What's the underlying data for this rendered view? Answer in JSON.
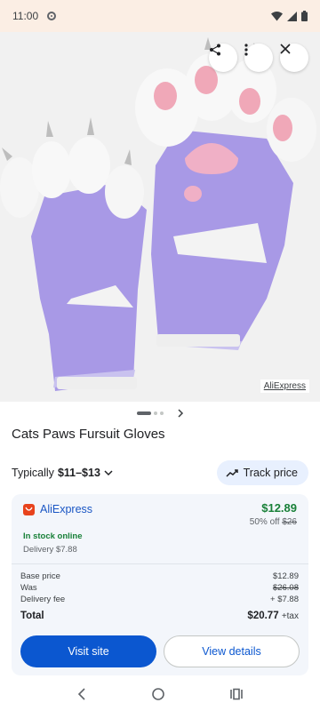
{
  "status_bar": {
    "time": "11:00"
  },
  "hero": {
    "source_label": "AliExpress"
  },
  "product": {
    "title": "Cats Paws Fursuit Gloves"
  },
  "pricing": {
    "typical_label": "Typically",
    "typical_range": "$11–$13",
    "track_label": "Track price"
  },
  "offer": {
    "merchant": "AliExpress",
    "price": "$12.89",
    "discount_label": "50% off",
    "original_price": "$26",
    "stock": "In stock online",
    "delivery": "Delivery $7.88",
    "breakdown": [
      {
        "label": "Base price",
        "value": "$12.89"
      },
      {
        "label": "Was",
        "value": "$26.08"
      },
      {
        "label": "Delivery fee",
        "value": "+ $7.88"
      }
    ],
    "total_label": "Total",
    "total_value": "$20.77",
    "tax_label": "+tax",
    "visit_label": "Visit site",
    "details_label": "View details"
  },
  "colors": {
    "accent": "#0b57d0",
    "price_green": "#188038",
    "merchant_blue": "#1a56c4",
    "ali_orange": "#e8431c",
    "glove_purple": "#a899e6",
    "status_bg": "#fbeee4"
  },
  "icons": [
    "settings-icon",
    "wifi-icon",
    "signal-icon",
    "battery-icon",
    "share-icon",
    "more-vert-icon",
    "close-icon",
    "chevron-down-icon",
    "trend-icon",
    "back-icon",
    "home-icon",
    "recents-icon"
  ]
}
